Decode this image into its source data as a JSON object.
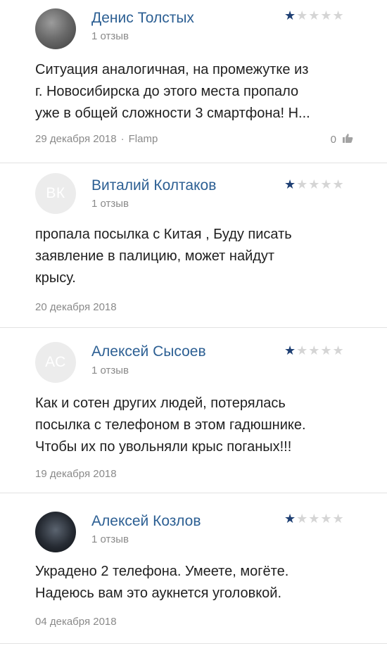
{
  "colors": {
    "name": "#2c5f93",
    "star_on": "#1e3f73",
    "star_off": "#d5d5d5",
    "meta": "#8a8a8a"
  },
  "reviews": [
    {
      "name": "Денис Толстых",
      "count": "1 отзыв",
      "rating": 1,
      "avatar": "photo",
      "lines": [
        "Ситуация аналогичная, на промежутке из",
        "г. Новосибирска до этого места пропало",
        "уже в общей сложности 3 смартфона! Н..."
      ],
      "date": "29 декабря 2018",
      "source": "Flamp",
      "likes": "0",
      "like_icon": "thumbs-up-icon"
    },
    {
      "name": "Виталий Колтаков",
      "count": "1 отзыв",
      "rating": 1,
      "avatar_initials": "ВК",
      "lines": [
        "пропала посылка с Китая , Буду писать",
        "заявление в палицию, может найдут",
        "крысу."
      ],
      "date": "20 декабря 2018"
    },
    {
      "name": "Алексей Сысоев",
      "count": "1 отзыв",
      "rating": 1,
      "avatar_initials": "АС",
      "lines": [
        "Как и сотен других людей, потерялась",
        "посылка с телефоном в этом гадюшнике.",
        "Чтобы их по увольняли крыс поганых!!!"
      ],
      "date": "19 декабря 2018"
    },
    {
      "name": "Алексей Козлов",
      "count": "1 отзыв",
      "rating": 1,
      "avatar": "photo",
      "lines": [
        "Украдено 2 телефона. Умеете, могёте.",
        "Надеюсь вам это аукнется уголовкой."
      ],
      "date": "04 декабря 2018"
    }
  ]
}
